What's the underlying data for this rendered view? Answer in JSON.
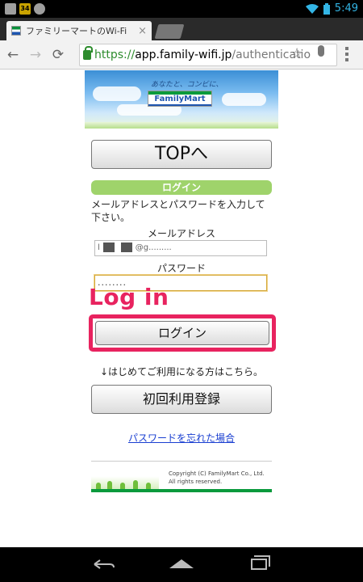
{
  "status_bar": {
    "notification_badge": "34",
    "time": "5:49",
    "icons": [
      "image-icon",
      "badge-icon",
      "messenger-icon",
      "wifi-icon",
      "battery-icon"
    ]
  },
  "browser": {
    "tab_title": "ファミリーマートのWi-Fi",
    "tab_close": "×",
    "url_https": "https://",
    "url_host": "app.family-wifi.jp",
    "url_path": "/authenticatio",
    "back_icon": "←",
    "forward_icon": "→",
    "reload_icon": "⟳",
    "star_icon": "☆"
  },
  "banner": {
    "tagline": "あなたと、コンビに、",
    "logo": "FamilyMart"
  },
  "page": {
    "top_button": "TOPへ",
    "section_title": "ログイン",
    "instructions": "メールアドレスとパスワードを入力して下さい。",
    "email_label": "メールアドレス",
    "email_value_start": "l",
    "email_value_end": "@g.........",
    "password_label": "パスワード",
    "password_value": "........",
    "annotation": "Log in",
    "login_button": "ログイン",
    "first_time_note": "↓はじめてご利用になる方はこちら。",
    "register_button": "初回利用登録",
    "forgot_link": "パスワードを忘れた場合"
  },
  "footer": {
    "copyright_line1": "Copyright (C) FamilyMart Co., Ltd.",
    "copyright_line2": "All rights reserved."
  },
  "colors": {
    "accent_pink": "#e8235f",
    "section_green": "#9fd36b",
    "brand_green": "#0a9a3c",
    "brand_blue": "#1e56b0",
    "link_blue": "#1a3fd1"
  }
}
